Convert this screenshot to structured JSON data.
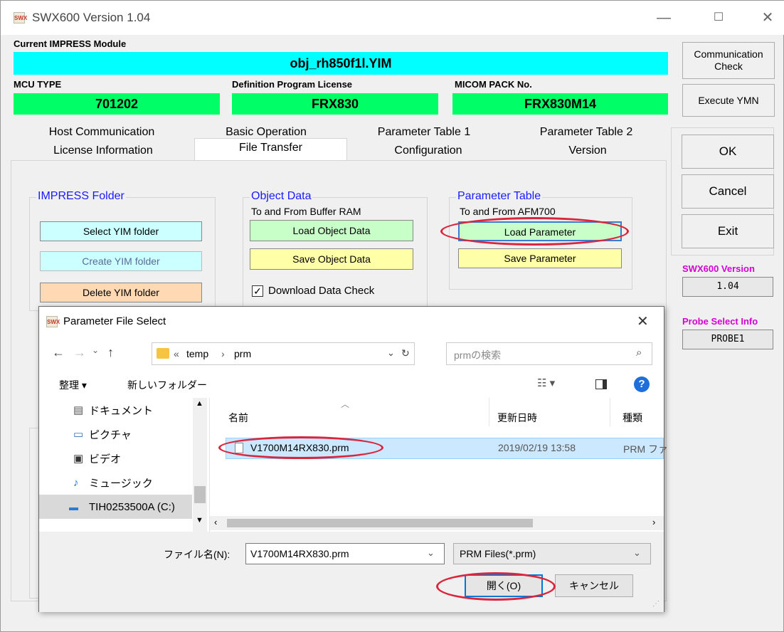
{
  "window": {
    "title": "SWX600   Version  1.04",
    "logo": "SWX"
  },
  "module": {
    "label": "Current IMPRESS Module",
    "value": "obj_rh850f1l.YIM"
  },
  "mcu": {
    "label": "MCU TYPE",
    "value": "701202"
  },
  "license": {
    "label": "Definition Program License",
    "value": "FRX830"
  },
  "micom": {
    "label": "MICOM PACK No.",
    "value": "FRX830M14"
  },
  "side": {
    "comm_check": "Communication Check",
    "execute": "Execute YMN",
    "ok": "OK",
    "cancel": "Cancel",
    "exit": "Exit",
    "version_label": "SWX600 Version",
    "version_value": "1.04",
    "probe_label": "Probe Select Info",
    "probe_value": "PROBE1"
  },
  "tabs_row1": [
    "Host Communication",
    "Basic Operation",
    "Parameter Table 1",
    "Parameter Table 2"
  ],
  "tabs_row2": [
    "License Information",
    "File Transfer",
    "Configuration",
    "Version"
  ],
  "impress": {
    "title": "IMPRESS Folder",
    "select": "Select YIM folder",
    "create": "Create YIM folder",
    "delete": "Delete YIM folder"
  },
  "object": {
    "title": "Object Data",
    "subtitle": "To and From Buffer RAM",
    "load": "Load Object Data",
    "save": "Save Object Data",
    "check": "Download Data Check"
  },
  "param": {
    "title": "Parameter Table",
    "subtitle": "To and From AFM700",
    "load": "Load Parameter",
    "save": "Save Parameter"
  },
  "dialog": {
    "title": "Parameter File Select",
    "path": [
      "«",
      "temp",
      "›",
      "prm"
    ],
    "search_placeholder": "prmの検索",
    "organize": "整理 ▾",
    "new_folder": "新しいフォルダー",
    "tree": [
      "ドキュメント",
      "ピクチャ",
      "ビデオ",
      "ミュージック",
      "TIH0253500A (C:)"
    ],
    "columns": {
      "name": "名前",
      "date": "更新日時",
      "type": "種類"
    },
    "file": {
      "name": "V1700M14RX830.prm",
      "date": "2019/02/19 13:58",
      "type": "PRM ファ"
    },
    "filename_label": "ファイル名(N):",
    "filename_value": "V1700M14RX830.prm",
    "filter": "PRM Files(*.prm)",
    "open": "開く(O)",
    "cancel": "キャンセル"
  }
}
